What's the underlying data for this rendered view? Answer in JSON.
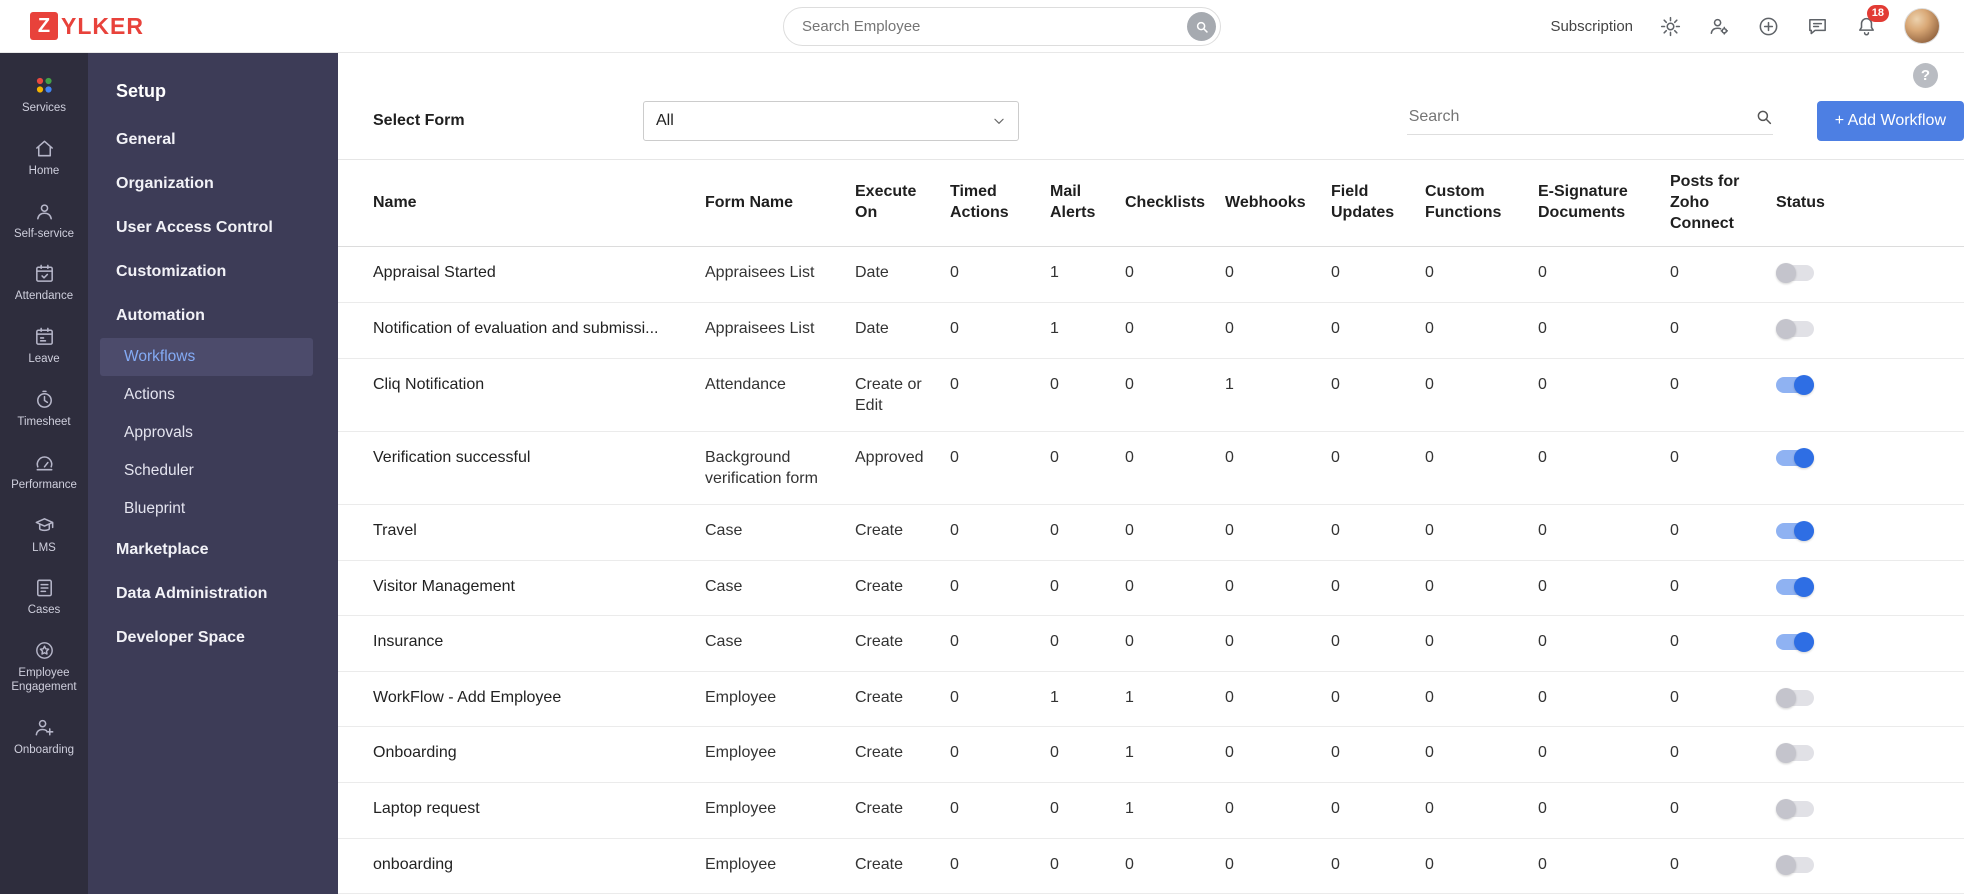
{
  "header": {
    "logo_badge": "Z",
    "logo_text": "YLKER",
    "search_placeholder": "Search Employee",
    "subscription_label": "Subscription",
    "notification_count": "18"
  },
  "icon_sidebar": {
    "items": [
      {
        "label": "Services",
        "icon": "services-icon"
      },
      {
        "label": "Home",
        "icon": "home-icon"
      },
      {
        "label": "Self-service",
        "icon": "self-service-icon"
      },
      {
        "label": "Attendance",
        "icon": "attendance-icon"
      },
      {
        "label": "Leave",
        "icon": "leave-icon"
      },
      {
        "label": "Timesheet",
        "icon": "timesheet-icon"
      },
      {
        "label": "Performance",
        "icon": "performance-icon"
      },
      {
        "label": "LMS",
        "icon": "lms-icon"
      },
      {
        "label": "Cases",
        "icon": "cases-icon"
      },
      {
        "label": "Employee Engagement",
        "icon": "employee-engagement-icon"
      },
      {
        "label": "Onboarding",
        "icon": "onboarding-icon"
      }
    ]
  },
  "settings_sidebar": {
    "title": "Setup",
    "items": [
      {
        "label": "General",
        "type": "item"
      },
      {
        "label": "Organization",
        "type": "item"
      },
      {
        "label": "User Access Control",
        "type": "item"
      },
      {
        "label": "Customization",
        "type": "item"
      },
      {
        "label": "Automation",
        "type": "item"
      },
      {
        "label": "Workflows",
        "type": "subitem",
        "active": true
      },
      {
        "label": "Actions",
        "type": "subitem"
      },
      {
        "label": "Approvals",
        "type": "subitem"
      },
      {
        "label": "Scheduler",
        "type": "subitem"
      },
      {
        "label": "Blueprint",
        "type": "subitem"
      },
      {
        "label": "Marketplace",
        "type": "item"
      },
      {
        "label": "Data Administration",
        "type": "item"
      },
      {
        "label": "Developer Space",
        "type": "item"
      }
    ]
  },
  "main": {
    "help_label": "?",
    "toolbar": {
      "select_form_label": "Select Form",
      "select_form_value": "All",
      "search_placeholder": "Search",
      "add_workflow_label": "+ Add Workflow"
    }
  },
  "table": {
    "columns": [
      "Name",
      "Form Name",
      "Execute On",
      "Timed Actions",
      "Mail Alerts",
      "Checklists",
      "Webhooks",
      "Field Updates",
      "Custom Functions",
      "E-Signature Documents",
      "Posts for Zoho Connect",
      "Status"
    ],
    "rows": [
      {
        "name": "Appraisal Started",
        "form_name": "Appraisees List",
        "execute_on": "Date",
        "counts": [
          0,
          1,
          0,
          0,
          0,
          0,
          0,
          0
        ],
        "status_on": false
      },
      {
        "name": "Notification of evaluation and submissi...",
        "form_name": "Appraisees List",
        "execute_on": "Date",
        "counts": [
          0,
          1,
          0,
          0,
          0,
          0,
          0,
          0
        ],
        "status_on": false
      },
      {
        "name": "Cliq Notification",
        "form_name": "Attendance",
        "execute_on": "Create or Edit",
        "counts": [
          0,
          0,
          0,
          1,
          0,
          0,
          0,
          0
        ],
        "status_on": true
      },
      {
        "name": "Verification successful",
        "form_name": "Background verification form",
        "execute_on": "Approved",
        "counts": [
          0,
          0,
          0,
          0,
          0,
          0,
          0,
          0
        ],
        "status_on": true
      },
      {
        "name": "Travel",
        "form_name": "Case",
        "execute_on": "Create",
        "counts": [
          0,
          0,
          0,
          0,
          0,
          0,
          0,
          0
        ],
        "status_on": true
      },
      {
        "name": "Visitor Management",
        "form_name": "Case",
        "execute_on": "Create",
        "counts": [
          0,
          0,
          0,
          0,
          0,
          0,
          0,
          0
        ],
        "status_on": true
      },
      {
        "name": "Insurance",
        "form_name": "Case",
        "execute_on": "Create",
        "counts": [
          0,
          0,
          0,
          0,
          0,
          0,
          0,
          0
        ],
        "status_on": true
      },
      {
        "name": "WorkFlow - Add Employee",
        "form_name": "Employee",
        "execute_on": "Create",
        "counts": [
          0,
          1,
          1,
          0,
          0,
          0,
          0,
          0
        ],
        "status_on": false
      },
      {
        "name": "Onboarding",
        "form_name": "Employee",
        "execute_on": "Create",
        "counts": [
          0,
          0,
          1,
          0,
          0,
          0,
          0,
          0
        ],
        "status_on": false
      },
      {
        "name": "Laptop request",
        "form_name": "Employee",
        "execute_on": "Create",
        "counts": [
          0,
          0,
          1,
          0,
          0,
          0,
          0,
          0
        ],
        "status_on": false
      },
      {
        "name": "onboarding",
        "form_name": "Employee",
        "execute_on": "Create",
        "counts": [
          0,
          0,
          0,
          0,
          0,
          0,
          0,
          0
        ],
        "status_on": false
      }
    ]
  },
  "colors": {
    "logo_red": "#e8423b",
    "accent_blue": "#4d7fe3",
    "toggle_on": "#2e6ee4",
    "toggle_off": "#c4c4cc"
  }
}
